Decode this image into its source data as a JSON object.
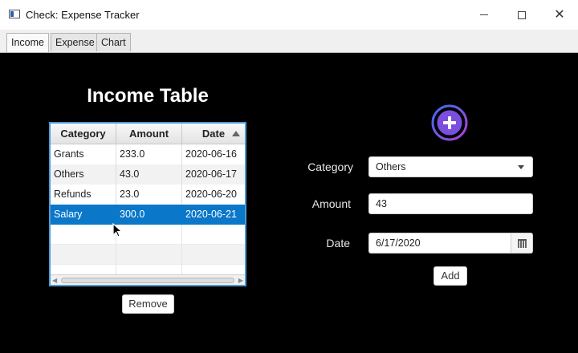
{
  "window": {
    "title": "Check: Expense Tracker"
  },
  "tabs": [
    {
      "label": "Income",
      "active": true
    },
    {
      "label": "Expense",
      "active": false
    },
    {
      "label": "Chart",
      "active": false
    }
  ],
  "income": {
    "title": "Income Table",
    "table": {
      "columns": [
        "Category",
        "Amount",
        "Date"
      ],
      "sorted_column": "Date",
      "sort_direction": "ascending",
      "rows": [
        {
          "category": "Grants",
          "amount": "233.0",
          "date": "2020-06-16"
        },
        {
          "category": "Others",
          "amount": "43.0",
          "date": "2020-06-17"
        },
        {
          "category": "Refunds",
          "amount": "23.0",
          "date": "2020-06-20"
        },
        {
          "category": "Salary",
          "amount": "300.0",
          "date": "2020-06-21",
          "selected": true
        }
      ]
    },
    "remove_label": "Remove"
  },
  "form": {
    "category_label": "Category",
    "category_value": "Others",
    "amount_label": "Amount",
    "amount_value": "43",
    "date_label": "Date",
    "date_value": "6/17/2020",
    "add_label": "Add"
  },
  "colors": {
    "background": "#000000",
    "selection": "#0a77c9",
    "table_border": "#4b9ad8",
    "plus_ring_start": "#3b6cf0",
    "plus_ring_end": "#b13fd6"
  },
  "icons": [
    "app-icon",
    "minimize-icon",
    "maximize-icon",
    "close-icon",
    "sort-ascending-icon",
    "dropdown-arrow-icon",
    "calendar-icon",
    "add-circle-icon",
    "mouse-cursor-icon"
  ]
}
